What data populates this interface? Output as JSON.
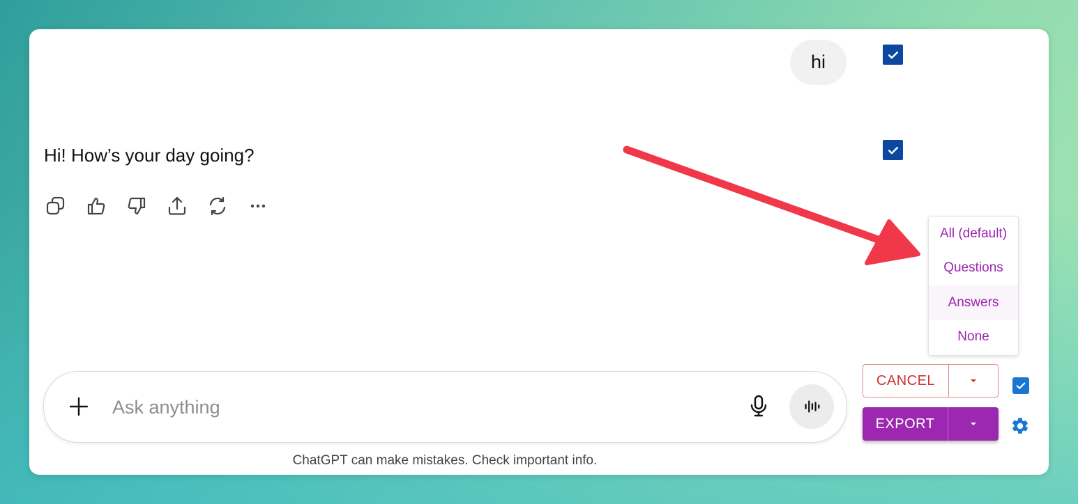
{
  "conversation": {
    "user_message": "hi",
    "assistant_message": "Hi! How’s your day going?",
    "message_actions": [
      "copy-icon",
      "thumbs-up-icon",
      "thumbs-down-icon",
      "share-icon",
      "regenerate-icon",
      "more-icon"
    ]
  },
  "export_menu": {
    "options": [
      "All (default)",
      "Questions",
      "Answers",
      "None"
    ],
    "highlighted": "Answers"
  },
  "composer": {
    "placeholder": "Ask anything",
    "value": ""
  },
  "footer": {
    "disclaimer": "ChatGPT can make mistakes. Check important info."
  },
  "buttons": {
    "cancel_label": "CANCEL",
    "export_label": "EXPORT"
  },
  "colors": {
    "accent_purple": "#9c27b0",
    "cancel_red": "#d32f2f",
    "checkbox_blue": "#0d47a1",
    "annotation_arrow": "#f0384a"
  }
}
